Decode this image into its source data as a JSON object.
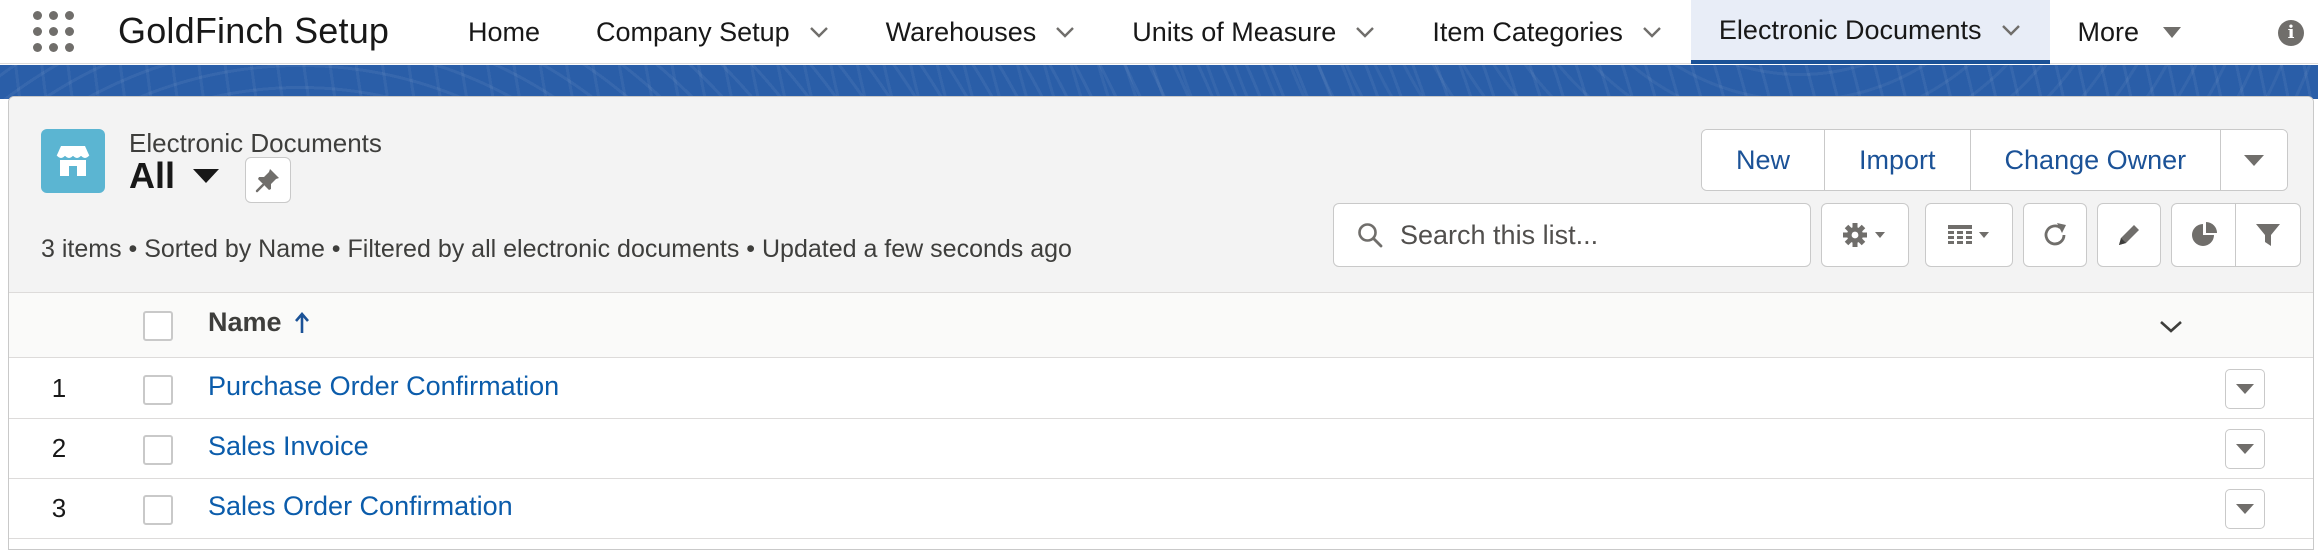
{
  "app": {
    "name": "GoldFinch Setup"
  },
  "nav": {
    "items": [
      {
        "label": "Home",
        "has_menu": false
      },
      {
        "label": "Company Setup",
        "has_menu": true
      },
      {
        "label": "Warehouses",
        "has_menu": true
      },
      {
        "label": "Units of Measure",
        "has_menu": true
      },
      {
        "label": "Item Categories",
        "has_menu": true
      },
      {
        "label": "Electronic Documents",
        "has_menu": true,
        "active": true
      },
      {
        "label": "More",
        "has_menu": true
      }
    ]
  },
  "list_view": {
    "object_label": "Electronic Documents",
    "view_name": "All",
    "meta": "3 items • Sorted by Name • Filtered by all electronic documents • Updated a few seconds ago",
    "actions": {
      "new": "New",
      "import": "Import",
      "change_owner": "Change Owner"
    },
    "search": {
      "placeholder": "Search this list..."
    },
    "columns": {
      "name": "Name"
    },
    "rows": [
      {
        "num": "1",
        "name": "Purchase Order Confirmation"
      },
      {
        "num": "2",
        "name": "Sales Invoice"
      },
      {
        "num": "3",
        "name": "Sales Order Confirmation"
      }
    ]
  },
  "icons": {
    "app_launcher": "waffle-icon",
    "info": "info-icon",
    "object": "storefront-icon",
    "pin": "pin-icon",
    "search": "search-icon",
    "settings": "gear-icon",
    "display": "table-icon",
    "refresh": "refresh-icon",
    "edit": "pencil-icon",
    "charts": "pie-chart-icon",
    "filter": "filter-icon"
  },
  "colors": {
    "brand_band": "#2a5ea8",
    "link": "#0b5cab",
    "button_text": "#1b5297",
    "object_icon": "#5bb5d2",
    "active_tab_bg": "#e8edf7"
  }
}
